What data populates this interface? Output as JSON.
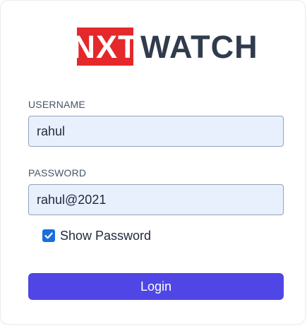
{
  "logo": {
    "badge_text": "NXT",
    "text": "WATCH"
  },
  "form": {
    "username_label": "USERNAME",
    "username_value": "rahul",
    "password_label": "PASSWORD",
    "password_value": "rahul@2021",
    "show_password_label": "Show Password",
    "show_password_checked": true,
    "login_label": "Login"
  },
  "icons": {
    "checkbox": "checkmark-icon"
  },
  "colors": {
    "logo_red": "#e5282b",
    "logo_dark": "#303b4d",
    "input_background": "#e8f0fe",
    "checkbox_blue": "#1a6fdb",
    "button_purple": "#4f46e5"
  }
}
